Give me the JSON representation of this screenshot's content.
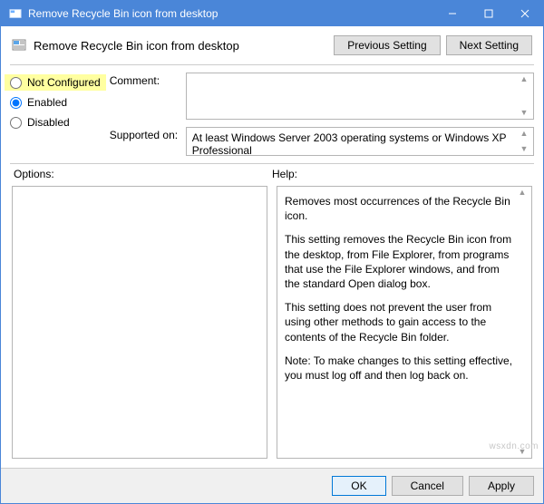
{
  "window": {
    "title": "Remove Recycle Bin icon from desktop"
  },
  "header": {
    "title": "Remove Recycle Bin icon from desktop",
    "prev_label": "Previous Setting",
    "next_label": "Next Setting"
  },
  "config": {
    "radios": {
      "not_configured": "Not Configured",
      "enabled": "Enabled",
      "disabled": "Disabled",
      "selected": "enabled"
    },
    "comment_label": "Comment:",
    "comment_value": "",
    "supported_label": "Supported on:",
    "supported_value": "At least Windows Server 2003 operating systems or Windows XP Professional"
  },
  "options": {
    "label": "Options:",
    "content": ""
  },
  "help": {
    "label": "Help:",
    "p1": "Removes most occurrences of the Recycle Bin icon.",
    "p2": "This setting removes the Recycle Bin icon from the desktop, from File Explorer, from programs that use the File Explorer windows, and from the standard Open dialog box.",
    "p3": "This setting does not prevent the user from using other methods to gain access to the contents of the Recycle Bin folder.",
    "p4": "Note: To make changes to this setting effective, you must log off and then log back on."
  },
  "footer": {
    "ok": "OK",
    "cancel": "Cancel",
    "apply": "Apply"
  },
  "watermark": "wsxdn.com"
}
